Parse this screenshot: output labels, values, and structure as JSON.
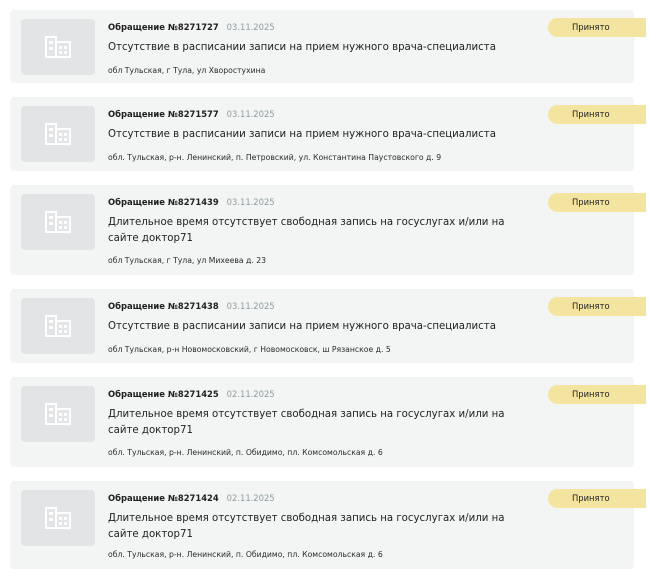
{
  "appeals": [
    {
      "number": "Обращение №8271727",
      "date": "03.11.2025",
      "topic": "Отсутствие в расписании записи на прием нужного врача-специалиста",
      "address": "обл Тульская, г Тула, ул Хворостухина",
      "status": "Принято",
      "icon": "building-icon"
    },
    {
      "number": "Обращение №8271577",
      "date": "03.11.2025",
      "topic": "Отсутствие в расписании записи на прием нужного врача-специалиста",
      "address": "обл. Тульская, р-н. Ленинский, п. Петровский, ул. Константина Паустовского д. 9",
      "status": "Принято",
      "icon": "building-icon"
    },
    {
      "number": "Обращение №8271439",
      "date": "03.11.2025",
      "topic": "Длительное время отсутствует свободная запись на госуслугах и/или на сайте доктор71",
      "address": "обл Тульская, г Тула, ул Михеева д. 23",
      "status": "Принято",
      "icon": "building-icon"
    },
    {
      "number": "Обращение №8271438",
      "date": "03.11.2025",
      "topic": "Отсутствие в расписании записи на прием нужного врача-специалиста",
      "address": "обл Тульская, р-н Новомосковский, г Новомосковск, ш Рязанское д. 5",
      "status": "Принято",
      "icon": "building-icon"
    },
    {
      "number": "Обращение №8271425",
      "date": "02.11.2025",
      "topic": "Длительное время отсутствует свободная запись на госуслугах и/или на сайте доктор71",
      "address": "обл. Тульская, р-н. Ленинский, п. Обидимо, пл. Комсомольская д. 6",
      "status": "Принято",
      "icon": "building-icon"
    },
    {
      "number": "Обращение №8271424",
      "date": "02.11.2025",
      "topic": "Длительное время отсутствует свободная запись на госуслугах и/или на сайте доктор71",
      "address": "обл. Тульская, р-н. Ленинский, п. Обидимо, пл. Комсомольская д. 6",
      "status": "Принято",
      "icon": "building-icon"
    }
  ],
  "colors": {
    "card_bg": "#f3f4f4",
    "thumb_bg": "#e2e4e5",
    "status_bg": "#f3e59f",
    "date_text": "#8e9c9f"
  }
}
